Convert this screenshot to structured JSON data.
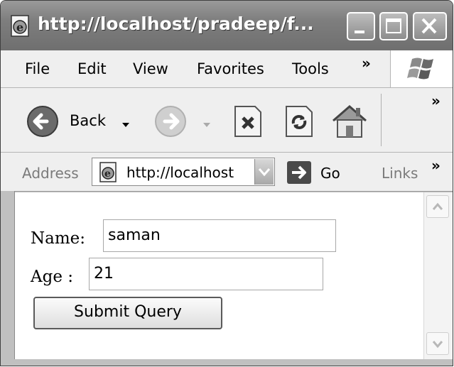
{
  "window": {
    "title": "http://localhost/pradeep/f..."
  },
  "menubar": {
    "items": [
      "File",
      "Edit",
      "View",
      "Favorites",
      "Tools"
    ],
    "overflow": "»"
  },
  "toolbar": {
    "back_label": "Back",
    "overflow": "»"
  },
  "addressbar": {
    "label": "Address",
    "url": "http://localhost",
    "go_label": "Go",
    "links_label": "Links",
    "overflow": "»"
  },
  "form": {
    "name_label": "Name:",
    "name_value": "saman",
    "age_label": "Age :",
    "age_value": "21",
    "submit_label": "Submit Query"
  },
  "icons": {
    "page": "ie-page-icon",
    "minimize": "minimize-icon",
    "maximize": "maximize-icon",
    "close": "close-icon",
    "back": "back-arrow-icon",
    "forward": "forward-arrow-icon",
    "stop": "stop-icon",
    "refresh": "refresh-icon",
    "home": "home-icon",
    "go": "go-arrow-icon",
    "windows_logo": "windows-logo-icon"
  }
}
